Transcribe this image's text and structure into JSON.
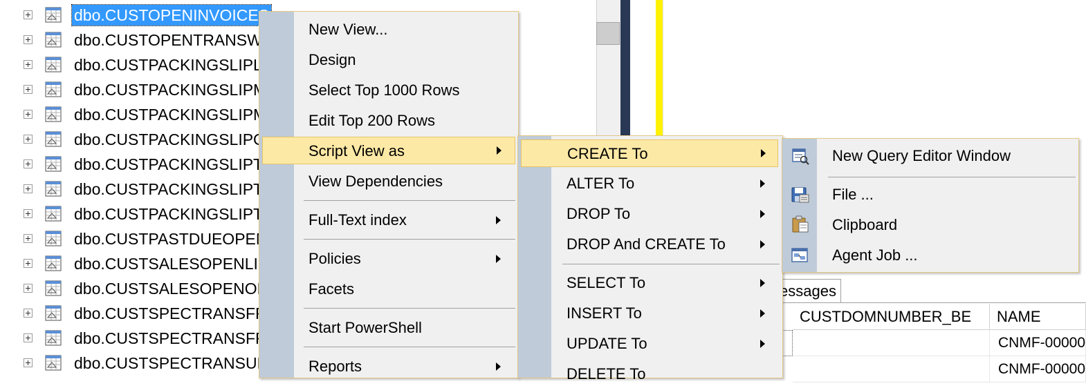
{
  "tree": {
    "items": [
      {
        "label": "dbo.CUSTOPENINVOICES",
        "selected": true
      },
      {
        "label": "dbo.CUSTOPENTRANSWI"
      },
      {
        "label": "dbo.CUSTPACKINGSLIPLA"
      },
      {
        "label": "dbo.CUSTPACKINGSLIPM"
      },
      {
        "label": "dbo.CUSTPACKINGSLIPM"
      },
      {
        "label": "dbo.CUSTPACKINGSLIPO"
      },
      {
        "label": "dbo.CUSTPACKINGSLIPTI"
      },
      {
        "label": "dbo.CUSTPACKINGSLIPTI"
      },
      {
        "label": "dbo.CUSTPACKINGSLIPTI"
      },
      {
        "label": "dbo.CUSTPASTDUEOPEN"
      },
      {
        "label": "dbo.CUSTSALESOPENLIN"
      },
      {
        "label": "dbo.CUSTSALESOPENORI"
      },
      {
        "label": "dbo.CUSTSPECTRANSFRO"
      },
      {
        "label": "dbo.CUSTSPECTRANSFRO"
      },
      {
        "label": "dbo.CUSTSPECTRANSUN"
      }
    ]
  },
  "context_menu": {
    "items": {
      "new_view": "New View...",
      "design": "Design",
      "select_top": "Select Top 1000 Rows",
      "edit_top": "Edit Top 200 Rows",
      "script_view_as": "Script View as",
      "view_dependencies": "View Dependencies",
      "full_text_index": "Full-Text index",
      "policies": "Policies",
      "facets": "Facets",
      "start_powershell": "Start PowerShell",
      "reports": "Reports"
    }
  },
  "script_menu": {
    "items": {
      "create_to": "CREATE To",
      "alter_to": "ALTER To",
      "drop_to": "DROP To",
      "drop_and_create_to": "DROP And CREATE To",
      "select_to": "SELECT To",
      "insert_to": "INSERT To",
      "update_to": "UPDATE To",
      "delete_to": "DELETE To"
    }
  },
  "create_menu": {
    "items": {
      "new_query_editor_window": "New Query Editor Window",
      "file": "File ...",
      "clipboard": "Clipboard",
      "agent_job": "Agent Job ..."
    }
  },
  "results": {
    "tab_label": "essages",
    "columns": [
      "CUSTDOMNUMBER_BE",
      "NAME"
    ],
    "rows": [
      [
        "",
        "CNMF-00000"
      ],
      [
        "",
        "CNMF-00000"
      ]
    ]
  },
  "colors": {
    "selection": "#3399ff",
    "menu_highlight": "#fde9a6",
    "menu_gutter": "#bfcbd9",
    "menu_border": "#e3c886"
  },
  "icons": {
    "tree_view": "view-icon",
    "new_query": "new-query-icon",
    "file": "save-file-icon",
    "clipboard": "clipboard-icon",
    "agent_job": "agent-job-icon"
  }
}
